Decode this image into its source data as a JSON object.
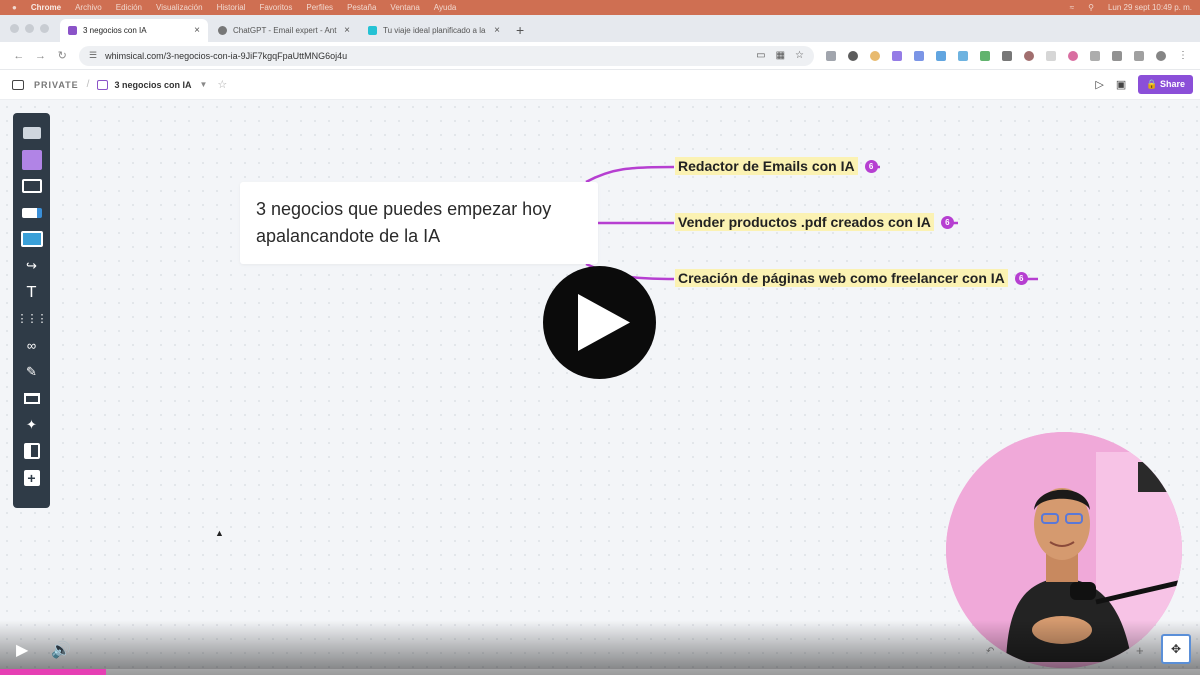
{
  "menubar": {
    "app": "Chrome",
    "items": [
      "Archivo",
      "Edición",
      "Visualización",
      "Historial",
      "Favoritos",
      "Perfiles",
      "Pestaña",
      "Ventana",
      "Ayuda"
    ],
    "clock": "Lun 29 sept 10:49 p. m."
  },
  "tabs": [
    {
      "label": "3 negocios con IA",
      "color": "#8b53c8"
    },
    {
      "label": "ChatGPT - Email expert - Ant",
      "color": "#777777"
    },
    {
      "label": "Tu viaje ideal planificado a la",
      "color": "#25c2d4"
    }
  ],
  "address_bar": {
    "url": "whimsical.com/3-negocios-con-ia-9JiF7kgqFpaUttMNG6oj4u"
  },
  "app_header": {
    "private_label": "PRIVATE",
    "board_title": "3 negocios con IA",
    "share_label": "Share"
  },
  "mindmap": {
    "root": "3 negocios que puedes empezar hoy apalancandote de la IA",
    "branches": [
      {
        "label": "Redactor de Emails con IA",
        "count": "6"
      },
      {
        "label": "Vender productos .pdf creados con IA",
        "count": "6"
      },
      {
        "label": "Creación de páginas web como freelancer con IA",
        "count": "6"
      }
    ],
    "branch_color": "#b63fd1",
    "highlight_color": "#fbf2b3"
  },
  "video": {
    "progress": 0.088,
    "accent": "#e63fb4"
  }
}
